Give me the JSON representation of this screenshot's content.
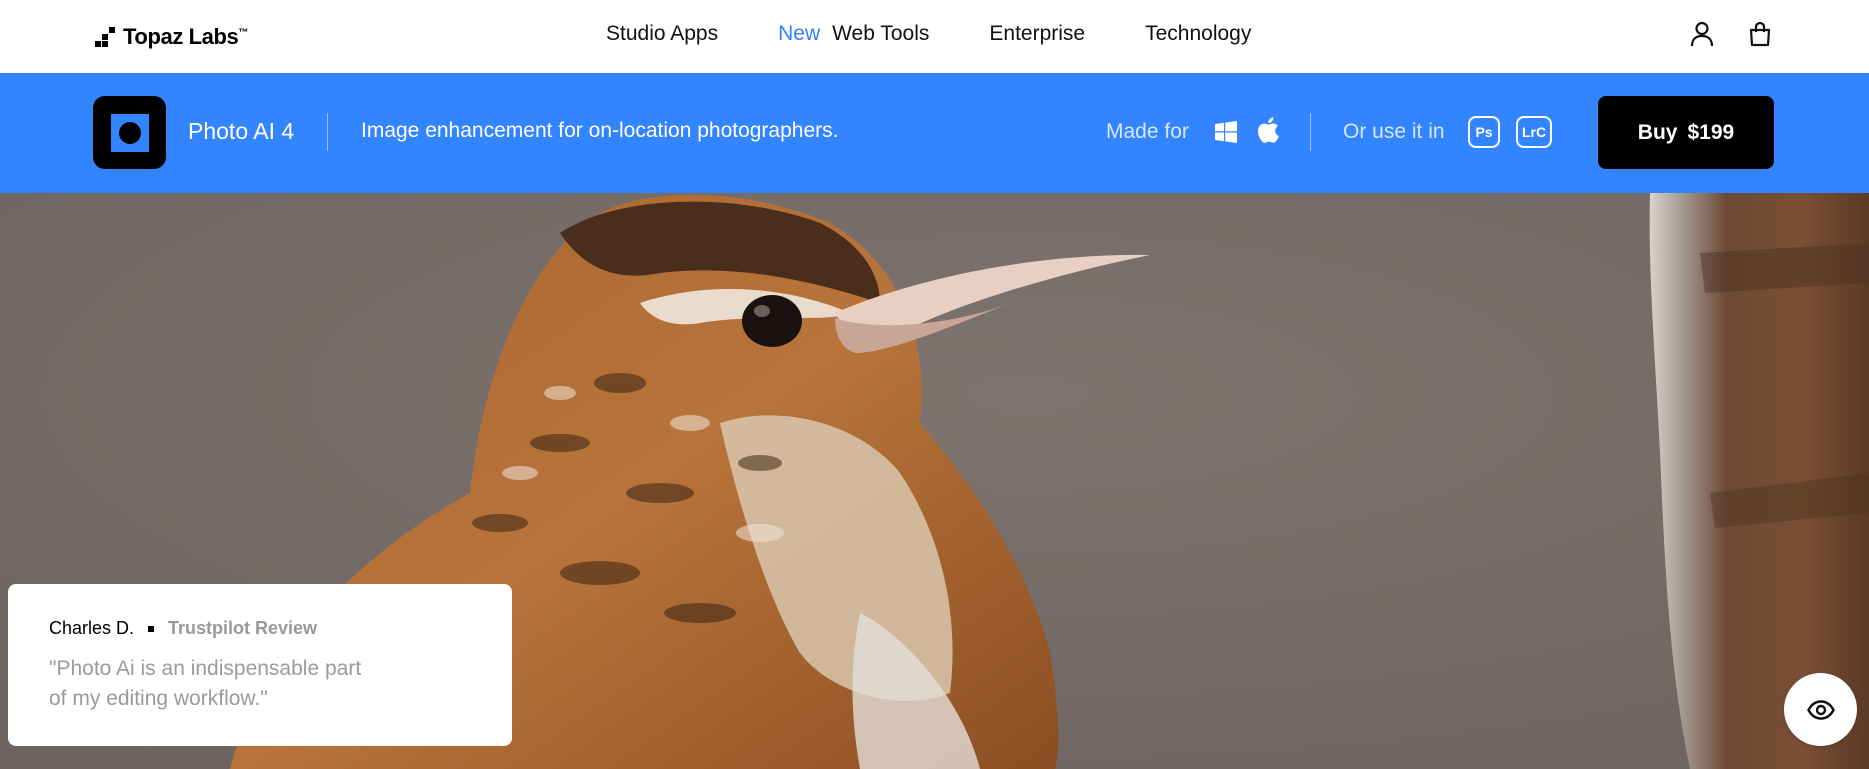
{
  "brand": {
    "name": "Topaz Labs",
    "trademark": "™"
  },
  "nav": {
    "items": [
      {
        "label": "Studio Apps"
      },
      {
        "badge": "New",
        "label": "Web Tools"
      },
      {
        "label": "Enterprise"
      },
      {
        "label": "Technology"
      }
    ],
    "icons": [
      "user-icon",
      "shopping-bag-icon"
    ]
  },
  "product_bar": {
    "app_name": "Photo AI 4",
    "tagline": "Image enhancement for on-location photographers.",
    "made_for_label": "Made for",
    "platform_icons": [
      "windows-icon",
      "apple-icon"
    ],
    "use_in_label": "Or use it in",
    "plugins": [
      "Ps",
      "LrC"
    ],
    "buy_label": "Buy",
    "price": "$199",
    "accent_color": "#3384ff"
  },
  "review": {
    "name": "Charles D.",
    "source": "Trustpilot Review",
    "quote": "\"Photo Ai is an indispensable part of my editing workflow.\""
  },
  "hero": {
    "image": "wren-bird-photo"
  },
  "controls": {
    "eye_button": "eye-icon"
  }
}
